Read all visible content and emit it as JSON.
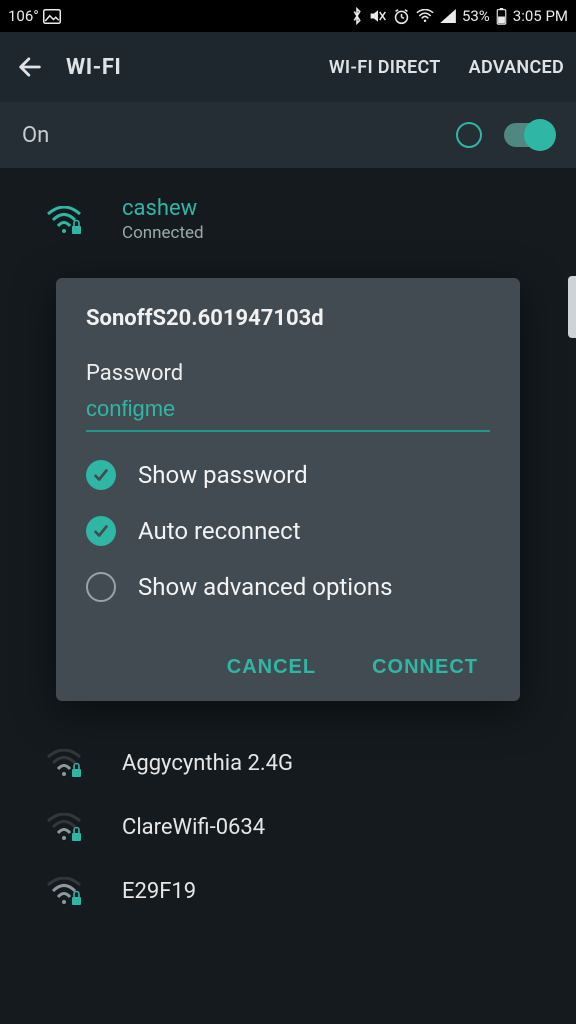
{
  "statusbar": {
    "temp": "106°",
    "battery": "53%",
    "time": "3:05 PM"
  },
  "appbar": {
    "title": "WI-FI",
    "action1": "WI-FI DIRECT",
    "action2": "ADVANCED"
  },
  "toggle": {
    "label": "On"
  },
  "networks": {
    "connected": {
      "name": "cashew",
      "status": "Connected"
    },
    "others": [
      {
        "name": "Aggycynthia 2.4G"
      },
      {
        "name": "ClareWifi-0634"
      },
      {
        "name": "E29F19"
      }
    ]
  },
  "dialog": {
    "title": "SonoffS20.601947103d",
    "password_label": "Password",
    "password_value": "configme",
    "show_password": "Show password",
    "auto_reconnect": "Auto reconnect",
    "show_advanced": "Show advanced options",
    "cancel": "CANCEL",
    "connect": "CONNECT"
  }
}
